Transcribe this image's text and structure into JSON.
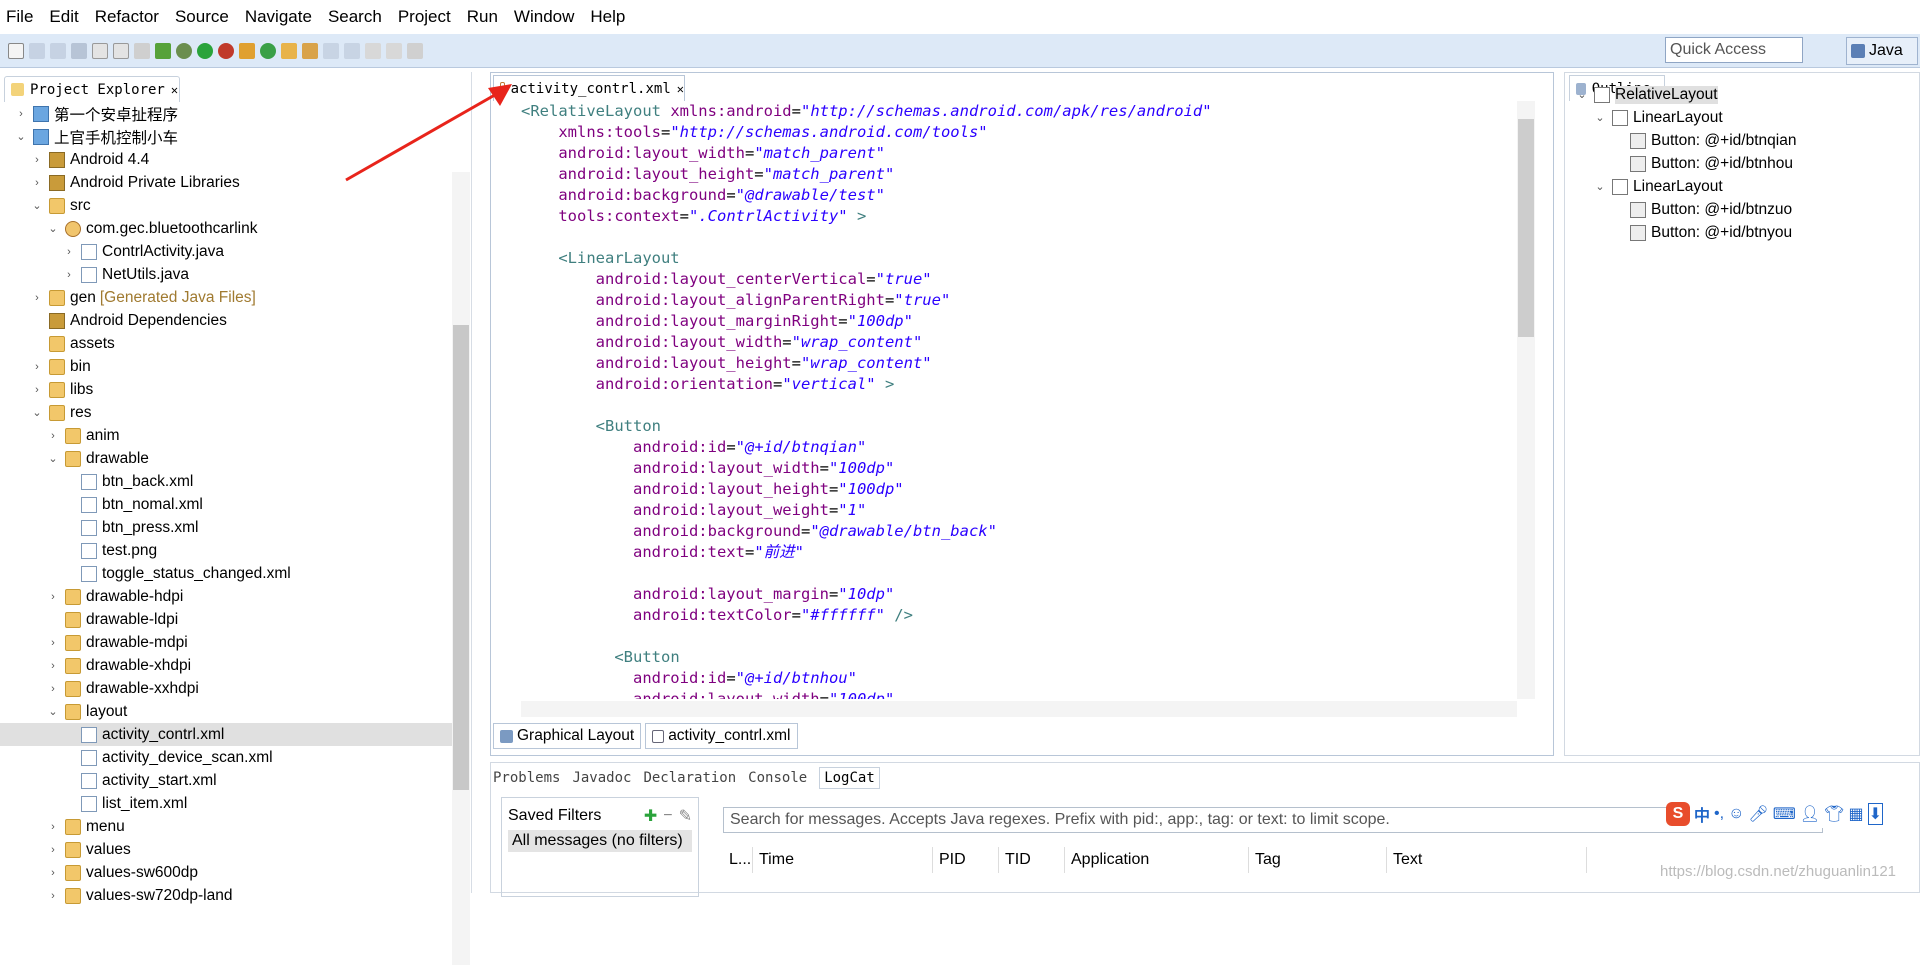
{
  "menu": [
    "File",
    "Edit",
    "Refactor",
    "Source",
    "Navigate",
    "Search",
    "Project",
    "Run",
    "Window",
    "Help"
  ],
  "quick_access": "Quick Access",
  "perspective": "Java",
  "project_explorer": {
    "title": "Project Explorer",
    "items": [
      {
        "label": "第一个安卓扯程序",
        "indent": 0,
        "arrow": "›",
        "icon": "proj"
      },
      {
        "label": "上官手机控制小车",
        "indent": 0,
        "arrow": "⌄",
        "icon": "proj"
      },
      {
        "label": "Android 4.4",
        "indent": 1,
        "arrow": "›",
        "icon": "lib"
      },
      {
        "label": "Android Private Libraries",
        "indent": 1,
        "arrow": "›",
        "icon": "lib"
      },
      {
        "label": "src",
        "indent": 1,
        "arrow": "⌄",
        "icon": "fold"
      },
      {
        "label": "com.gec.bluetoothcarlink",
        "indent": 2,
        "arrow": "⌄",
        "icon": "pkg"
      },
      {
        "label": "ContrlActivity.java",
        "indent": 3,
        "arrow": "›",
        "icon": "file"
      },
      {
        "label": "NetUtils.java",
        "indent": 3,
        "arrow": "›",
        "icon": "file"
      },
      {
        "label": "gen",
        "suffix": "[Generated Java Files]",
        "indent": 1,
        "arrow": "›",
        "icon": "fold"
      },
      {
        "label": "Android Dependencies",
        "indent": 1,
        "arrow": "",
        "icon": "lib"
      },
      {
        "label": "assets",
        "indent": 1,
        "arrow": "",
        "icon": "fold"
      },
      {
        "label": "bin",
        "indent": 1,
        "arrow": "›",
        "icon": "fold"
      },
      {
        "label": "libs",
        "indent": 1,
        "arrow": "›",
        "icon": "fold"
      },
      {
        "label": "res",
        "indent": 1,
        "arrow": "⌄",
        "icon": "fold"
      },
      {
        "label": "anim",
        "indent": 2,
        "arrow": "›",
        "icon": "fold"
      },
      {
        "label": "drawable",
        "indent": 2,
        "arrow": "⌄",
        "icon": "fold"
      },
      {
        "label": "btn_back.xml",
        "indent": 3,
        "arrow": "",
        "icon": "file"
      },
      {
        "label": "btn_nomal.xml",
        "indent": 3,
        "arrow": "",
        "icon": "file"
      },
      {
        "label": "btn_press.xml",
        "indent": 3,
        "arrow": "",
        "icon": "file"
      },
      {
        "label": "test.png",
        "indent": 3,
        "arrow": "",
        "icon": "file"
      },
      {
        "label": "toggle_status_changed.xml",
        "indent": 3,
        "arrow": "",
        "icon": "file"
      },
      {
        "label": "drawable-hdpi",
        "indent": 2,
        "arrow": "›",
        "icon": "fold"
      },
      {
        "label": "drawable-ldpi",
        "indent": 2,
        "arrow": "",
        "icon": "fold"
      },
      {
        "label": "drawable-mdpi",
        "indent": 2,
        "arrow": "›",
        "icon": "fold"
      },
      {
        "label": "drawable-xhdpi",
        "indent": 2,
        "arrow": "›",
        "icon": "fold"
      },
      {
        "label": "drawable-xxhdpi",
        "indent": 2,
        "arrow": "›",
        "icon": "fold"
      },
      {
        "label": "layout",
        "indent": 2,
        "arrow": "⌄",
        "icon": "fold"
      },
      {
        "label": "activity_contrl.xml",
        "indent": 3,
        "arrow": "",
        "icon": "file",
        "selected": true
      },
      {
        "label": "activity_device_scan.xml",
        "indent": 3,
        "arrow": "",
        "icon": "file"
      },
      {
        "label": "activity_start.xml",
        "indent": 3,
        "arrow": "",
        "icon": "file"
      },
      {
        "label": "list_item.xml",
        "indent": 3,
        "arrow": "",
        "icon": "file"
      },
      {
        "label": "menu",
        "indent": 2,
        "arrow": "›",
        "icon": "fold"
      },
      {
        "label": "values",
        "indent": 2,
        "arrow": "›",
        "icon": "fold"
      },
      {
        "label": "values-sw600dp",
        "indent": 2,
        "arrow": "›",
        "icon": "fold"
      },
      {
        "label": "values-sw720dp-land",
        "indent": 2,
        "arrow": "›",
        "icon": "fold"
      }
    ]
  },
  "editor": {
    "tab": "activity_contrl.xml",
    "bottom_tabs": [
      "Graphical Layout",
      "activity_contrl.xml"
    ],
    "lines": [
      [
        {
          "t": "tg",
          "s": "<RelativeLayout "
        },
        {
          "t": "at",
          "s": "xmlns:android"
        },
        {
          "t": "",
          "s": "="
        },
        {
          "t": "vl",
          "s": "\"http://schemas.android.com/apk/res/android\""
        }
      ],
      [
        {
          "t": "",
          "s": "    "
        },
        {
          "t": "at",
          "s": "xmlns:tools"
        },
        {
          "t": "",
          "s": "="
        },
        {
          "t": "vl",
          "s": "\"http://schemas.android.com/tools\""
        }
      ],
      [
        {
          "t": "",
          "s": "    "
        },
        {
          "t": "at",
          "s": "android:layout_width"
        },
        {
          "t": "",
          "s": "="
        },
        {
          "t": "vl",
          "s": "\"match_parent\""
        }
      ],
      [
        {
          "t": "",
          "s": "    "
        },
        {
          "t": "at",
          "s": "android:layout_height"
        },
        {
          "t": "",
          "s": "="
        },
        {
          "t": "vl",
          "s": "\"match_parent\""
        }
      ],
      [
        {
          "t": "",
          "s": "    "
        },
        {
          "t": "at",
          "s": "android:background"
        },
        {
          "t": "",
          "s": "="
        },
        {
          "t": "vl",
          "s": "\"@drawable/test\""
        }
      ],
      [
        {
          "t": "",
          "s": "    "
        },
        {
          "t": "at",
          "s": "tools:context"
        },
        {
          "t": "",
          "s": "="
        },
        {
          "t": "vl",
          "s": "\".ContrlActivity\""
        },
        {
          "t": "tg",
          "s": " >"
        }
      ],
      [
        {
          "t": "",
          "s": ""
        }
      ],
      [
        {
          "t": "",
          "s": "    "
        },
        {
          "t": "tg",
          "s": "<LinearLayout"
        }
      ],
      [
        {
          "t": "",
          "s": "        "
        },
        {
          "t": "at",
          "s": "android:layout_centerVertical"
        },
        {
          "t": "",
          "s": "="
        },
        {
          "t": "vl",
          "s": "\"true\""
        }
      ],
      [
        {
          "t": "",
          "s": "        "
        },
        {
          "t": "at",
          "s": "android:layout_alignParentRight"
        },
        {
          "t": "",
          "s": "="
        },
        {
          "t": "vl",
          "s": "\"true\""
        }
      ],
      [
        {
          "t": "",
          "s": "        "
        },
        {
          "t": "at",
          "s": "android:layout_marginRight"
        },
        {
          "t": "",
          "s": "="
        },
        {
          "t": "vl",
          "s": "\"100dp\""
        }
      ],
      [
        {
          "t": "",
          "s": "        "
        },
        {
          "t": "at",
          "s": "android:layout_width"
        },
        {
          "t": "",
          "s": "="
        },
        {
          "t": "vl",
          "s": "\"wrap_content\""
        }
      ],
      [
        {
          "t": "",
          "s": "        "
        },
        {
          "t": "at",
          "s": "android:layout_height"
        },
        {
          "t": "",
          "s": "="
        },
        {
          "t": "vl",
          "s": "\"wrap_content\""
        }
      ],
      [
        {
          "t": "",
          "s": "        "
        },
        {
          "t": "at",
          "s": "android:orientation"
        },
        {
          "t": "",
          "s": "="
        },
        {
          "t": "vl",
          "s": "\"vertical\""
        },
        {
          "t": "tg",
          "s": " >"
        }
      ],
      [
        {
          "t": "",
          "s": ""
        }
      ],
      [
        {
          "t": "",
          "s": "        "
        },
        {
          "t": "tg",
          "s": "<Button"
        }
      ],
      [
        {
          "t": "",
          "s": "            "
        },
        {
          "t": "at",
          "s": "android:id"
        },
        {
          "t": "",
          "s": "="
        },
        {
          "t": "vl",
          "s": "\"@+id/btnqian\""
        }
      ],
      [
        {
          "t": "",
          "s": "            "
        },
        {
          "t": "at",
          "s": "android:layout_width"
        },
        {
          "t": "",
          "s": "="
        },
        {
          "t": "vl",
          "s": "\"100dp\""
        }
      ],
      [
        {
          "t": "",
          "s": "            "
        },
        {
          "t": "at",
          "s": "android:layout_height"
        },
        {
          "t": "",
          "s": "="
        },
        {
          "t": "vl",
          "s": "\"100dp\""
        }
      ],
      [
        {
          "t": "",
          "s": "            "
        },
        {
          "t": "at",
          "s": "android:layout_weight"
        },
        {
          "t": "",
          "s": "="
        },
        {
          "t": "vl",
          "s": "\"1\""
        }
      ],
      [
        {
          "t": "",
          "s": "            "
        },
        {
          "t": "at",
          "s": "android:background"
        },
        {
          "t": "",
          "s": "="
        },
        {
          "t": "vl",
          "s": "\"@drawable/btn_back\""
        }
      ],
      [
        {
          "t": "",
          "s": "            "
        },
        {
          "t": "at",
          "s": "android:text"
        },
        {
          "t": "",
          "s": "="
        },
        {
          "t": "vl",
          "s": "\"前进\""
        }
      ],
      [
        {
          "t": "",
          "s": ""
        }
      ],
      [
        {
          "t": "",
          "s": "            "
        },
        {
          "t": "at",
          "s": "android:layout_margin"
        },
        {
          "t": "",
          "s": "="
        },
        {
          "t": "vl",
          "s": "\"10dp\""
        }
      ],
      [
        {
          "t": "",
          "s": "            "
        },
        {
          "t": "at",
          "s": "android:textColor"
        },
        {
          "t": "",
          "s": "="
        },
        {
          "t": "vl",
          "s": "\"#ffffff\""
        },
        {
          "t": "tg",
          "s": " />"
        }
      ],
      [
        {
          "t": "",
          "s": ""
        }
      ],
      [
        {
          "t": "",
          "s": "          "
        },
        {
          "t": "tg",
          "s": "<Button"
        }
      ],
      [
        {
          "t": "",
          "s": "            "
        },
        {
          "t": "at",
          "s": "android:id"
        },
        {
          "t": "",
          "s": "="
        },
        {
          "t": "vl",
          "s": "\"@+id/btnhou\""
        }
      ],
      [
        {
          "t": "",
          "s": "            "
        },
        {
          "t": "at",
          "s": "android:layout_width"
        },
        {
          "t": "",
          "s": "="
        },
        {
          "t": "vl",
          "s": "\"100dp\""
        }
      ]
    ]
  },
  "outline": {
    "title": "Outline",
    "items": [
      {
        "label": "RelativeLayout",
        "indent": 0,
        "arrow": "⌄",
        "selected": true
      },
      {
        "label": "LinearLayout",
        "indent": 1,
        "arrow": "⌄"
      },
      {
        "label": "Button: @+id/btnqian",
        "indent": 2,
        "arrow": ""
      },
      {
        "label": "Button: @+id/btnhou",
        "indent": 2,
        "arrow": ""
      },
      {
        "label": "LinearLayout",
        "indent": 1,
        "arrow": "⌄"
      },
      {
        "label": "Button: @+id/btnzuo",
        "indent": 2,
        "arrow": ""
      },
      {
        "label": "Button: @+id/btnyou",
        "indent": 2,
        "arrow": ""
      }
    ]
  },
  "bottom_panel": {
    "tabs": [
      "Problems",
      "Javadoc",
      "Declaration",
      "Console",
      "LogCat"
    ],
    "saved_filters": "Saved Filters",
    "all_messages": "All messages (no filters)",
    "search_placeholder": "Search for messages. Accepts Java regexes. Prefix with pid:, app:, tag: or text: to limit scope.",
    "columns": [
      "L...",
      "Time",
      "PID",
      "TID",
      "Application",
      "Tag",
      "Text"
    ]
  },
  "ime": {
    "logo": "S",
    "lang": "中"
  },
  "watermark": "https://blog.csdn.net/zhuguanlin121"
}
